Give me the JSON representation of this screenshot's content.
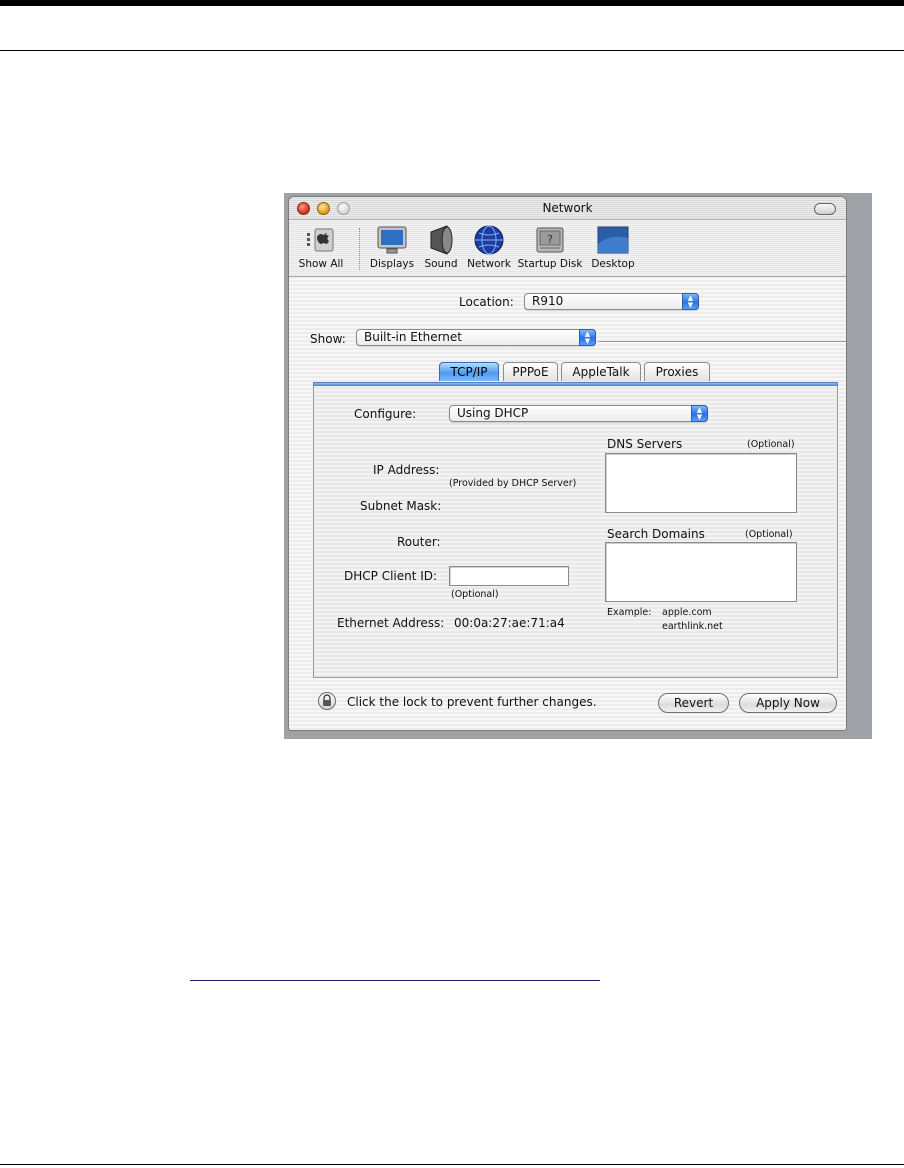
{
  "window": {
    "title": "Network"
  },
  "toolbar": {
    "items": [
      {
        "label": "Show All",
        "icon": "show-all-icon"
      },
      {
        "label": "Displays",
        "icon": "displays-icon"
      },
      {
        "label": "Sound",
        "icon": "sound-icon"
      },
      {
        "label": "Network",
        "icon": "network-globe-icon"
      },
      {
        "label": "Startup Disk",
        "icon": "startup-disk-icon"
      },
      {
        "label": "Desktop",
        "icon": "desktop-icon"
      }
    ]
  },
  "location": {
    "label": "Location:",
    "value": "R910"
  },
  "show": {
    "label": "Show:",
    "value": "Built-in Ethernet"
  },
  "tabs": [
    {
      "label": "TCP/IP",
      "active": true
    },
    {
      "label": "PPPoE",
      "active": false
    },
    {
      "label": "AppleTalk",
      "active": false
    },
    {
      "label": "Proxies",
      "active": false
    }
  ],
  "tcpip": {
    "configure_label": "Configure:",
    "configure_value": "Using DHCP",
    "ip_address_label": "IP Address:",
    "provided_note": "(Provided by DHCP Server)",
    "subnet_mask_label": "Subnet Mask:",
    "router_label": "Router:",
    "dhcp_client_id_label": "DHCP Client ID:",
    "dhcp_client_id_value": "",
    "optional_note": "(Optional)",
    "ethernet_address_label": "Ethernet Address:",
    "ethernet_address_value": "00:0a:27:ae:71:a4",
    "dns_servers_label": "DNS Servers",
    "dns_optional": "(Optional)",
    "search_domains_label": "Search Domains",
    "search_optional": "(Optional)",
    "example_label": "Example:",
    "example_line1": "apple.com",
    "example_line2": "earthlink.net"
  },
  "footer": {
    "lock_text": "Click the lock to prevent further changes.",
    "revert_label": "Revert",
    "apply_label": "Apply Now"
  }
}
